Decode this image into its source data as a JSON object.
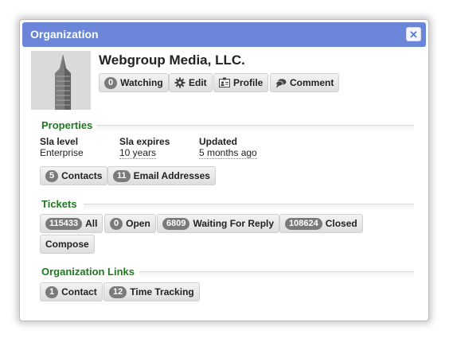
{
  "dialog": {
    "title": "Organization",
    "close_icon": "close-icon"
  },
  "org": {
    "name": "Webgroup Media, LLC."
  },
  "actions": {
    "watching": {
      "count": "0",
      "label": "Watching"
    },
    "edit": {
      "label": "Edit",
      "icon": "gear-icon"
    },
    "profile": {
      "label": "Profile",
      "icon": "id-card-icon"
    },
    "comment": {
      "label": "Comment",
      "icon": "speech-bubble-icon"
    }
  },
  "properties": {
    "title": "Properties",
    "sla_level": {
      "label": "Sla level",
      "value": "Enterprise"
    },
    "sla_expires": {
      "label": "Sla expires",
      "value": "10 years"
    },
    "updated": {
      "label": "Updated",
      "value": "5 months ago"
    },
    "contacts": {
      "count": "5",
      "label": "Contacts"
    },
    "email_addresses": {
      "count": "11",
      "label": "Email Addresses"
    }
  },
  "tickets": {
    "title": "Tickets",
    "all": {
      "count": "115433",
      "label": "All"
    },
    "open": {
      "count": "0",
      "label": "Open"
    },
    "waiting": {
      "count": "6809",
      "label": "Waiting For Reply"
    },
    "closed": {
      "count": "108624",
      "label": "Closed"
    },
    "compose": {
      "label": "Compose"
    }
  },
  "links": {
    "title": "Organization Links",
    "contact": {
      "count": "1",
      "label": "Contact"
    },
    "time_tracking": {
      "count": "12",
      "label": "Time Tracking"
    }
  },
  "colors": {
    "titlebar": "#6b86d8",
    "section_title": "#1d7a1d",
    "badge": "#7a7a7a"
  }
}
